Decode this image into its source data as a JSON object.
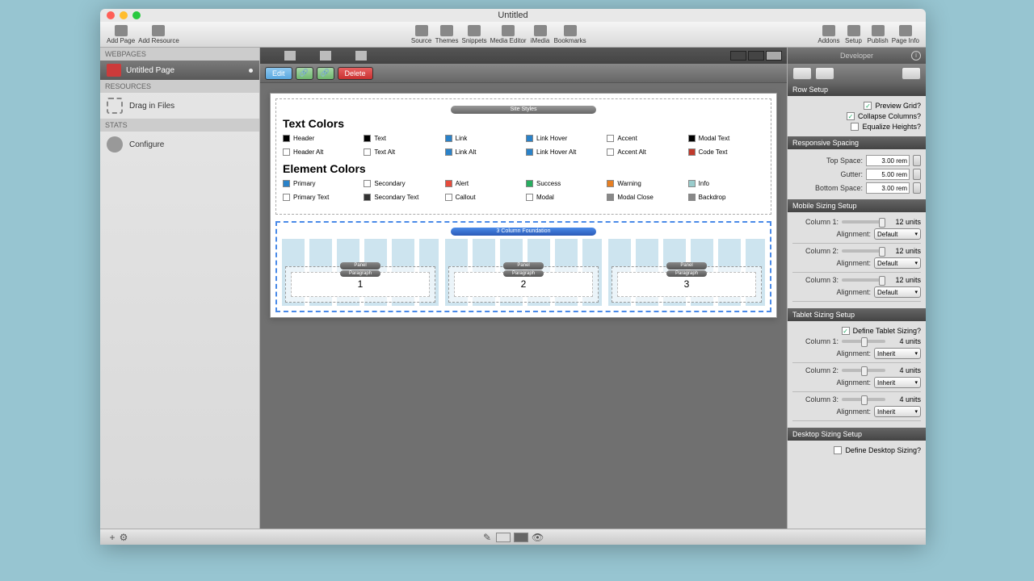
{
  "window": {
    "title": "Untitled"
  },
  "toolbar_left": {
    "add_page": "Add Page",
    "add_resource": "Add Resource"
  },
  "toolbar_center": {
    "source": "Source",
    "themes": "Themes",
    "snippets": "Snippets",
    "media_editor": "Media Editor",
    "imedia": "iMedia",
    "bookmarks": "Bookmarks"
  },
  "toolbar_right": {
    "addons": "Addons",
    "setup": "Setup",
    "publish": "Publish",
    "page_info": "Page Info"
  },
  "sidebar_left": {
    "webpages": "WEBPAGES",
    "page_name": "Untitled Page",
    "resources": "RESOURCES",
    "drag_in": "Drag in Files",
    "stats": "STATS",
    "configure": "Configure"
  },
  "editor": {
    "edit": "Edit",
    "delete": "Delete",
    "site_styles": "Site Styles",
    "text_colors": "Text Colors",
    "element_colors": "Element Colors",
    "foundation_label": "3 Column Foundation",
    "panel_label": "Panel",
    "paragraph_label": "Paragraph",
    "text_swatches_r1": [
      {
        "label": "Header",
        "color": "#000"
      },
      {
        "label": "Text",
        "color": "#000"
      },
      {
        "label": "Link",
        "color": "#2a82c9"
      },
      {
        "label": "Link Hover",
        "color": "#2a82c9"
      },
      {
        "label": "Accent",
        "color": "#fff"
      },
      {
        "label": "Modal Text",
        "color": "#000"
      }
    ],
    "text_swatches_r2": [
      {
        "label": "Header Alt",
        "color": "#fff"
      },
      {
        "label": "Text Alt",
        "color": "#fff"
      },
      {
        "label": "Link Alt",
        "color": "#2a82c9"
      },
      {
        "label": "Link Hover Alt",
        "color": "#2a82c9"
      },
      {
        "label": "Accent Alt",
        "color": "#fff"
      },
      {
        "label": "Code Text",
        "color": "#c0392b"
      }
    ],
    "elem_swatches_r1": [
      {
        "label": "Primary",
        "color": "#2a82c9"
      },
      {
        "label": "Secondary",
        "color": "#fff"
      },
      {
        "label": "Alert",
        "color": "#e74c3c"
      },
      {
        "label": "Success",
        "color": "#27ae60"
      },
      {
        "label": "Warning",
        "color": "#e67e22"
      },
      {
        "label": "Info",
        "color": "#9cc"
      }
    ],
    "elem_swatches_r2": [
      {
        "label": "Primary Text",
        "color": "#fff"
      },
      {
        "label": "Secondary Text",
        "color": "#333"
      },
      {
        "label": "Callout",
        "color": "#fff"
      },
      {
        "label": "Modal",
        "color": "#fff"
      },
      {
        "label": "Modal Close",
        "color": "#888"
      },
      {
        "label": "Backdrop",
        "color": "#888"
      }
    ],
    "panels": [
      "1",
      "2",
      "3"
    ]
  },
  "inspector": {
    "developer": "Developer",
    "row_setup": "Row Setup",
    "preview_grid": "Preview Grid?",
    "collapse_cols": "Collapse Columns?",
    "equalize": "Equalize Heights?",
    "responsive": "Responsive Spacing",
    "top_space": "Top Space:",
    "top_space_v": "3.00 rem",
    "gutter": "Gutter:",
    "gutter_v": "5.00 rem",
    "bottom_space": "Bottom Space:",
    "bottom_space_v": "3.00 rem",
    "mobile": "Mobile Sizing Setup",
    "col1": "Column 1:",
    "col2": "Column 2:",
    "col3": "Column 3:",
    "alignment": "Alignment:",
    "units12": "12 units",
    "default": "Default",
    "tablet": "Tablet Sizing Setup",
    "define_tablet": "Define Tablet Sizing?",
    "units4": "4 units",
    "inherit": "Inherit",
    "desktop": "Desktop Sizing Setup",
    "define_desktop": "Define Desktop Sizing?"
  }
}
